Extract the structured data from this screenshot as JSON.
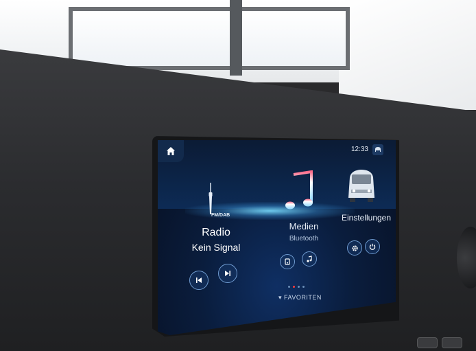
{
  "status_bar": {
    "time": "12:33"
  },
  "radio": {
    "band": "FM/DAB",
    "title": "Radio",
    "status": "Kein Signal"
  },
  "media": {
    "title": "Medien",
    "source": "Bluetooth"
  },
  "settings": {
    "title": "Einstellungen"
  },
  "footer": {
    "favorites_label": "FAVORITEN",
    "page_count": 4,
    "active_page": 2
  },
  "colors": {
    "accent_glow": "#78dcff",
    "page_indicator_active": "#ff3b3b",
    "screen_background": "#0a1d3d"
  },
  "icons": [
    "home-icon",
    "profile-icon",
    "tv-tower-icon",
    "music-note-icon",
    "van-icon",
    "skip-previous-icon",
    "skip-next-icon",
    "media-source-icon",
    "music-search-icon",
    "gear-icon",
    "power-icon",
    "chevron-down-icon"
  ]
}
